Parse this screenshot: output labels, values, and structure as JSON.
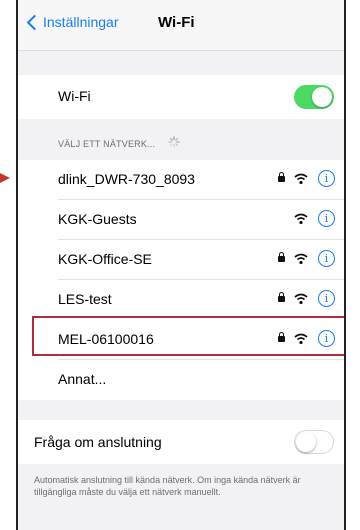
{
  "nav": {
    "back_label": "Inställningar",
    "title": "Wi-Fi"
  },
  "wifi_toggle": {
    "label": "Wi-Fi",
    "state": "on"
  },
  "networks_header": "VÄLJ ETT NÄTVERK...",
  "networks": [
    {
      "name": "dlink_DWR-730_8093",
      "locked": true
    },
    {
      "name": "KGK-Guests",
      "locked": false
    },
    {
      "name": "KGK-Office-SE",
      "locked": true
    },
    {
      "name": "LES-test",
      "locked": true
    },
    {
      "name": "MEL-06100016",
      "locked": true,
      "highlighted": true
    }
  ],
  "other_label": "Annat...",
  "ask_to_join": {
    "label": "Fråga om anslutning",
    "state": "off"
  },
  "footer_text": "Automatisk anslutning till kända nätverk. Om inga kända nätverk är tillgängliga måste du välja ett nätverk manuellt.",
  "colors": {
    "accent": "#1a7cf5",
    "toggle_on": "#4cd964",
    "highlight": "#b72a3d",
    "arrow": "#c0392b"
  }
}
